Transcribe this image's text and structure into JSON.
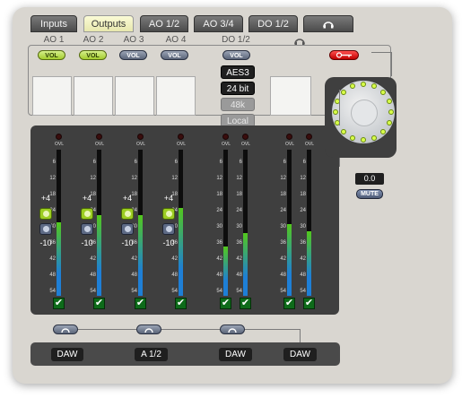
{
  "tabs": [
    {
      "label": "Inputs",
      "active": false
    },
    {
      "label": "Outputs",
      "active": true
    },
    {
      "label": "AO 1/2",
      "active": false
    },
    {
      "label": "AO 3/4",
      "active": false
    },
    {
      "label": "DO 1/2",
      "active": false
    },
    {
      "label": "",
      "icon": "headphones-icon",
      "active": false
    }
  ],
  "column_headers": [
    "AO 1",
    "AO 2",
    "AO 3",
    "AO 4",
    "DO 1/2"
  ],
  "headphones_header_icon": "headphones-icon",
  "vol_label": "VOL",
  "vol_buttons": [
    {
      "label": "VOL",
      "state": "on"
    },
    {
      "label": "VOL",
      "state": "on"
    },
    {
      "label": "VOL",
      "state": "off"
    },
    {
      "label": "VOL",
      "state": "off"
    },
    {
      "label": "VOL",
      "state": "off"
    }
  ],
  "key_button_icon": "key-icon",
  "digital_options": [
    "AES3",
    "24 bit",
    "48k",
    "Local"
  ],
  "meter_scale": [
    "6",
    "12",
    "18",
    "24",
    "30",
    "36",
    "42",
    "48",
    "54"
  ],
  "ovl_label": "OVL",
  "gain": {
    "high": "+4",
    "low": "-10"
  },
  "master": {
    "value": "0.0",
    "mute_label": "MUTE"
  },
  "bottom_buttons": [
    "DAW",
    "A 1/2",
    "DAW",
    "DAW"
  ],
  "colors": {
    "panel": "#d9d6d0",
    "dark": "#3f3f3f",
    "accent_green": "#a4cd2f",
    "meter_blue": "#1e7fd6",
    "meter_green": "#53c81c",
    "knob_led": "#d8ff4a",
    "key_red": "#e00000"
  }
}
